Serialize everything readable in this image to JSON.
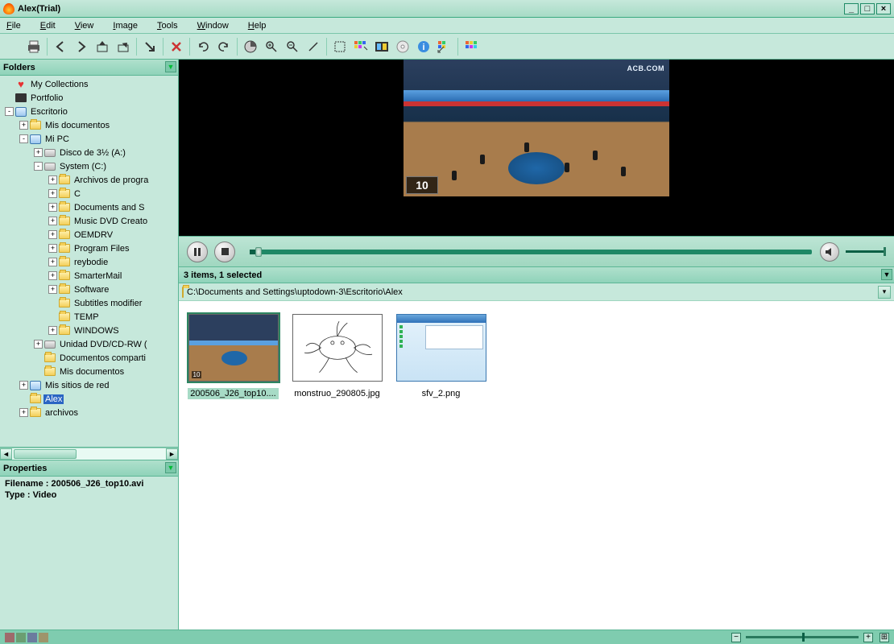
{
  "window": {
    "title": "Alex(Trial)"
  },
  "menu": [
    "File",
    "Edit",
    "View",
    "Image",
    "Tools",
    "Window",
    "Help"
  ],
  "panels": {
    "folders": "Folders",
    "properties": "Properties"
  },
  "tree": [
    {
      "d": 0,
      "tw": "",
      "icon": "heart",
      "label": "My Collections"
    },
    {
      "d": 0,
      "tw": "",
      "icon": "dark",
      "label": "Portfolio"
    },
    {
      "d": 0,
      "tw": "-",
      "icon": "pc",
      "label": "Escritorio"
    },
    {
      "d": 1,
      "tw": "+",
      "icon": "folder",
      "label": "Mis documentos"
    },
    {
      "d": 1,
      "tw": "-",
      "icon": "pc",
      "label": "Mi PC"
    },
    {
      "d": 2,
      "tw": "+",
      "icon": "drive",
      "label": "Disco de 3½ (A:)"
    },
    {
      "d": 2,
      "tw": "-",
      "icon": "drive",
      "label": "System (C:)"
    },
    {
      "d": 3,
      "tw": "+",
      "icon": "folder",
      "label": "Archivos de progra"
    },
    {
      "d": 3,
      "tw": "+",
      "icon": "folder",
      "label": "C"
    },
    {
      "d": 3,
      "tw": "+",
      "icon": "folder",
      "label": "Documents and S"
    },
    {
      "d": 3,
      "tw": "+",
      "icon": "folder",
      "label": "Music DVD Creato"
    },
    {
      "d": 3,
      "tw": "+",
      "icon": "folder",
      "label": "OEMDRV"
    },
    {
      "d": 3,
      "tw": "+",
      "icon": "folder",
      "label": "Program Files"
    },
    {
      "d": 3,
      "tw": "+",
      "icon": "folder",
      "label": "reybodie"
    },
    {
      "d": 3,
      "tw": "+",
      "icon": "folder",
      "label": "SmarterMail"
    },
    {
      "d": 3,
      "tw": "+",
      "icon": "folder",
      "label": "Software"
    },
    {
      "d": 3,
      "tw": "",
      "icon": "folder",
      "label": "Subtitles modifier"
    },
    {
      "d": 3,
      "tw": "",
      "icon": "folder",
      "label": "TEMP"
    },
    {
      "d": 3,
      "tw": "+",
      "icon": "folder",
      "label": "WINDOWS"
    },
    {
      "d": 2,
      "tw": "+",
      "icon": "drive",
      "label": "Unidad DVD/CD-RW ("
    },
    {
      "d": 2,
      "tw": "",
      "icon": "folder",
      "label": "Documentos comparti"
    },
    {
      "d": 2,
      "tw": "",
      "icon": "folder",
      "label": "Mis documentos"
    },
    {
      "d": 1,
      "tw": "+",
      "icon": "pc",
      "label": "Mis sitios de red"
    },
    {
      "d": 1,
      "tw": "",
      "icon": "folder",
      "label": "Alex",
      "sel": true
    },
    {
      "d": 1,
      "tw": "+",
      "icon": "folder",
      "label": "archivos"
    }
  ],
  "properties": {
    "filename_label": "Filename : ",
    "filename": "200506_J26_top10.avi",
    "type_label": "Type : ",
    "type": "Video"
  },
  "preview": {
    "score": "10",
    "logo": "ACB.COM"
  },
  "status": {
    "summary": "3 items, 1 selected"
  },
  "path": "C:\\Documents and Settings\\uptodown-3\\Escritorio\\Alex",
  "thumbs": [
    {
      "name": "200506_J26_top10....",
      "kind": "video",
      "sel": true,
      "score": "10"
    },
    {
      "name": "monstruo_290805.jpg",
      "kind": "drawing"
    },
    {
      "name": "sfv_2.png",
      "kind": "window"
    }
  ],
  "colors": [
    "#9e6b6b",
    "#6b9e72",
    "#6b7c9e",
    "#9e956b"
  ]
}
